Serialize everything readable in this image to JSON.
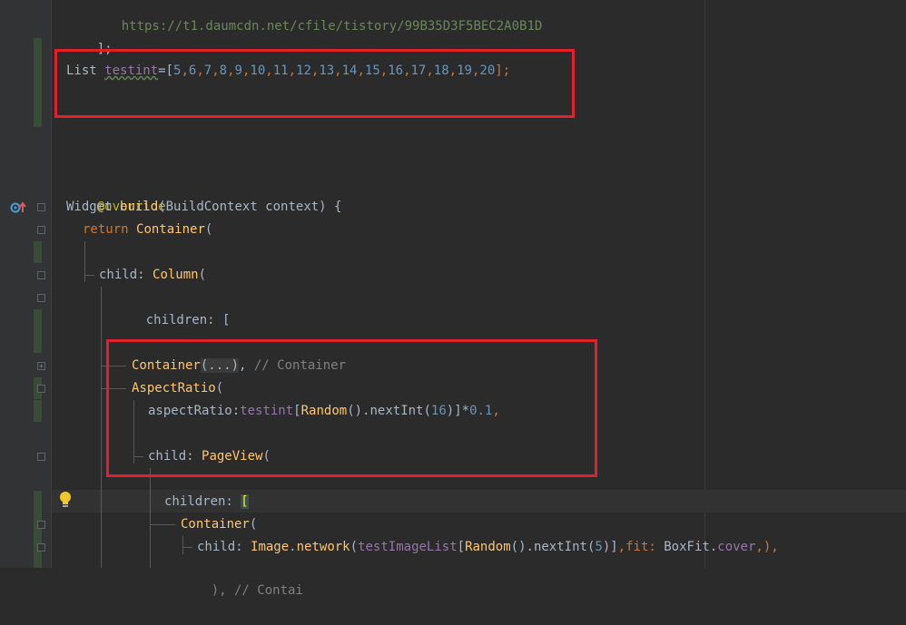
{
  "code": {
    "line_url": "https://t1.daumcdn.net/cfile/tistory/99B35D3F5BEC2A0B1D",
    "line_close": "];",
    "list_decl": {
      "type": "List",
      "name": "testint",
      "assign": "=",
      "open": "[",
      "numbers": [
        "5",
        "6",
        "7",
        "8",
        "9",
        "10",
        "11",
        "12",
        "13",
        "14",
        "15",
        "16",
        "17",
        "18",
        "19",
        "20"
      ],
      "close": "];"
    },
    "annotation": "@override",
    "build_sig": {
      "ret_type": "Widget",
      "name": "build",
      "params": "(BuildContext context) {"
    },
    "return_line": {
      "kw": "return",
      "cls": "Container",
      "rest": "("
    },
    "child_column": {
      "label": "child: ",
      "cls": "Column",
      "rest": "("
    },
    "children_open": "children: [",
    "container_folded": {
      "cls": "Container",
      "folded": "(...)",
      "rest": ", ",
      "comment": "// Container"
    },
    "aspect_ratio": {
      "cls": "AspectRatio",
      "rest": "("
    },
    "aspect_line": {
      "prop": "aspectRatio:",
      "var": "testint",
      "open": "[",
      "cls": "Random",
      "call": "().nextInt(",
      "arg": "16",
      "close": ")]*",
      "factor": "0.1",
      "end": ","
    },
    "child_pageview": {
      "label": "child: ",
      "cls": "PageView",
      "rest": "("
    },
    "children_bracket": {
      "label": "children: ",
      "bracket": "["
    },
    "container_inner": {
      "cls": "Container",
      "rest": "("
    },
    "image_line": {
      "label": "child: ",
      "cls": "Image",
      "dot": ".",
      "method": "network",
      "open": "(",
      "var": "testImageList",
      "idx_open": "[",
      "rnd": "Random",
      "call": "().nextInt(",
      "arg": "5",
      "idx_close": ")]",
      "fit_label": ",fit: ",
      "fit_cls": "BoxFit",
      "fit_dot": ".",
      "fit_val": "cover",
      "end": ",),"
    },
    "last_partial": "), // Contai"
  },
  "icons": {
    "gutter_override": "override-method-icon",
    "bulb": "lightbulb-icon"
  },
  "colors": {
    "highlight_box": "#e0202a",
    "background": "#2b2b2b"
  }
}
